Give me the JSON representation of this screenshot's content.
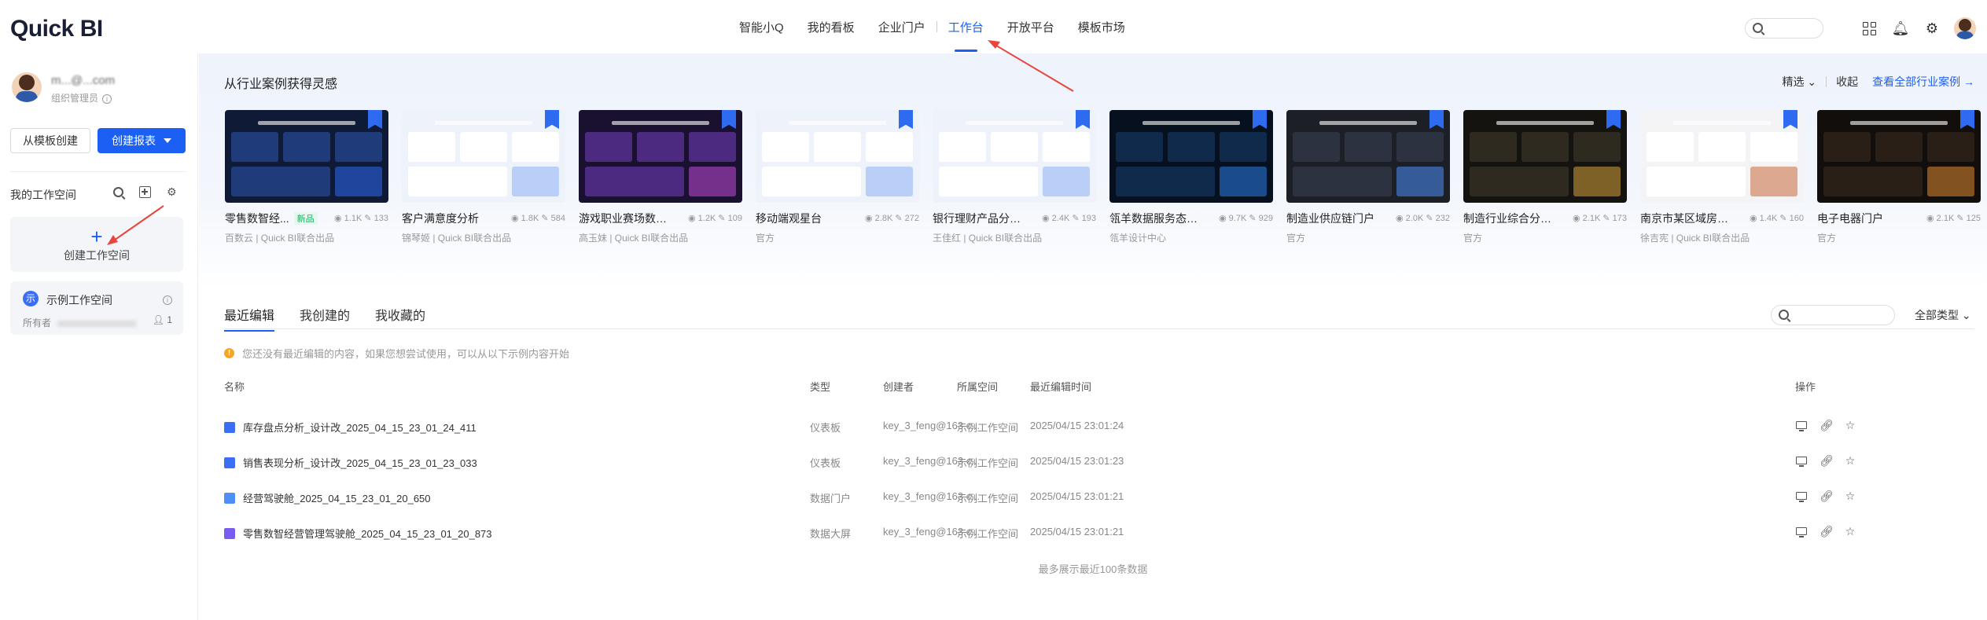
{
  "app": {
    "logo": "Quick BI"
  },
  "topnav": {
    "items": [
      "智能小Q",
      "我的看板",
      "企业门户",
      "工作台",
      "开放平台",
      "模板市场"
    ],
    "active_index": 3
  },
  "colors": {
    "accent": "#1b5ff5",
    "arrow": "#e8453c"
  },
  "sidebar": {
    "user_email": "m...@...com",
    "user_role": "组织管理员",
    "from_template_label": "从模板创建",
    "create_report_label": "创建报表",
    "workspace_title": "我的工作空间",
    "new_workspace": {
      "plus": "+",
      "label": "创建工作空间"
    },
    "demo_workspace": {
      "badge": "示",
      "name": "示例工作空间",
      "owner_label": "所有者",
      "member_count": "1"
    }
  },
  "inspire": {
    "title": "从行业案例获得灵感",
    "filter_label": "精选",
    "collapse_label": "收起",
    "view_all_label": "查看全部行业案例 →",
    "cards": [
      {
        "title": "零售数智经...",
        "tag": "新品",
        "views": "1.1K",
        "uses": "133",
        "author": "百数云 | Quick BI联合出品",
        "theme": "dark-blue"
      },
      {
        "title": "客户满意度分析",
        "tag": "",
        "views": "1.8K",
        "uses": "584",
        "author": "锦琴姬 | Quick BI联合出品",
        "theme": "light"
      },
      {
        "title": "游戏职业赛场数据...",
        "tag": "",
        "views": "1.2K",
        "uses": "109",
        "author": "高玉妹 | Quick BI联合出品",
        "theme": "purple"
      },
      {
        "title": "移动端观星台",
        "tag": "",
        "views": "2.8K",
        "uses": "272",
        "author": "官方",
        "theme": "light"
      },
      {
        "title": "银行理财产品分析...",
        "tag": "",
        "views": "2.4K",
        "uses": "193",
        "author": "王佳红 | Quick BI联合出品",
        "theme": "light"
      },
      {
        "title": "瓴羊数据服务态势...",
        "tag": "",
        "views": "9.7K",
        "uses": "929",
        "author": "瓴羊设计中心",
        "theme": "dark-map"
      },
      {
        "title": "制造业供应链门户",
        "tag": "",
        "views": "2.0K",
        "uses": "232",
        "author": "官方",
        "theme": "dark-gray"
      },
      {
        "title": "制造行业综合分析...",
        "tag": "",
        "views": "2.1K",
        "uses": "173",
        "author": "官方",
        "theme": "dark-gold"
      },
      {
        "title": "南京市某区域房屋...",
        "tag": "",
        "views": "1.4K",
        "uses": "160",
        "author": "徐吉宪 | Quick BI联合出品",
        "theme": "light-gray"
      },
      {
        "title": "电子电器门户",
        "tag": "",
        "views": "2.1K",
        "uses": "125",
        "author": "官方",
        "theme": "dark-amber"
      }
    ]
  },
  "recent": {
    "tabs": [
      "最近编辑",
      "我创建的",
      "我收藏的"
    ],
    "type_filter_label": "全部类型",
    "notice": "您还没有最近编辑的内容，如果您想尝试使用，可以从以下示例内容开始",
    "columns": [
      "名称",
      "类型",
      "创建者",
      "所属空间",
      "最近编辑时间",
      "操作"
    ],
    "rows": [
      {
        "name": "库存盘点分析_设计改_2025_04_15_23_01_24_411",
        "type": "仪表板",
        "creator": "key_3_feng@163.c...",
        "space": "示例工作空间",
        "time": "2025/04/15 23:01:24",
        "icon_color": "#3a6ef6"
      },
      {
        "name": "销售表现分析_设计改_2025_04_15_23_01_23_033",
        "type": "仪表板",
        "creator": "key_3_feng@163.c...",
        "space": "示例工作空间",
        "time": "2025/04/15 23:01:23",
        "icon_color": "#3a6ef6"
      },
      {
        "name": "经营驾驶舱_2025_04_15_23_01_20_650",
        "type": "数据门户",
        "creator": "key_3_feng@163.c...",
        "space": "示例工作空间",
        "time": "2025/04/15 23:01:21",
        "icon_color": "#4f8ef7"
      },
      {
        "name": "零售数智经营管理驾驶舱_2025_04_15_23_01_20_873",
        "type": "数据大屏",
        "creator": "key_3_feng@163.c...",
        "space": "示例工作空间",
        "time": "2025/04/15 23:01:21",
        "icon_color": "#7b5cf0"
      }
    ],
    "footer": "最多展示最近100条数据"
  }
}
